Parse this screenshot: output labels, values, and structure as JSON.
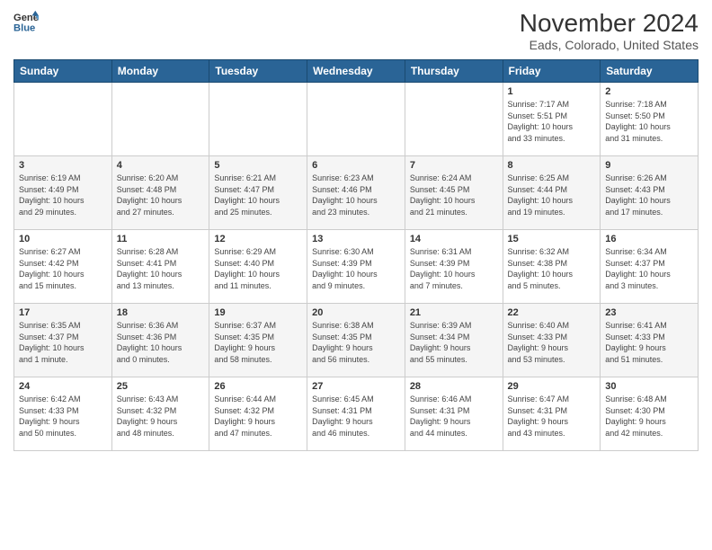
{
  "header": {
    "logo_line1": "General",
    "logo_line2": "Blue",
    "title": "November 2024",
    "subtitle": "Eads, Colorado, United States"
  },
  "weekdays": [
    "Sunday",
    "Monday",
    "Tuesday",
    "Wednesday",
    "Thursday",
    "Friday",
    "Saturday"
  ],
  "weeks": [
    [
      {
        "day": "",
        "info": ""
      },
      {
        "day": "",
        "info": ""
      },
      {
        "day": "",
        "info": ""
      },
      {
        "day": "",
        "info": ""
      },
      {
        "day": "",
        "info": ""
      },
      {
        "day": "1",
        "info": "Sunrise: 7:17 AM\nSunset: 5:51 PM\nDaylight: 10 hours\nand 33 minutes."
      },
      {
        "day": "2",
        "info": "Sunrise: 7:18 AM\nSunset: 5:50 PM\nDaylight: 10 hours\nand 31 minutes."
      }
    ],
    [
      {
        "day": "3",
        "info": "Sunrise: 6:19 AM\nSunset: 4:49 PM\nDaylight: 10 hours\nand 29 minutes."
      },
      {
        "day": "4",
        "info": "Sunrise: 6:20 AM\nSunset: 4:48 PM\nDaylight: 10 hours\nand 27 minutes."
      },
      {
        "day": "5",
        "info": "Sunrise: 6:21 AM\nSunset: 4:47 PM\nDaylight: 10 hours\nand 25 minutes."
      },
      {
        "day": "6",
        "info": "Sunrise: 6:23 AM\nSunset: 4:46 PM\nDaylight: 10 hours\nand 23 minutes."
      },
      {
        "day": "7",
        "info": "Sunrise: 6:24 AM\nSunset: 4:45 PM\nDaylight: 10 hours\nand 21 minutes."
      },
      {
        "day": "8",
        "info": "Sunrise: 6:25 AM\nSunset: 4:44 PM\nDaylight: 10 hours\nand 19 minutes."
      },
      {
        "day": "9",
        "info": "Sunrise: 6:26 AM\nSunset: 4:43 PM\nDaylight: 10 hours\nand 17 minutes."
      }
    ],
    [
      {
        "day": "10",
        "info": "Sunrise: 6:27 AM\nSunset: 4:42 PM\nDaylight: 10 hours\nand 15 minutes."
      },
      {
        "day": "11",
        "info": "Sunrise: 6:28 AM\nSunset: 4:41 PM\nDaylight: 10 hours\nand 13 minutes."
      },
      {
        "day": "12",
        "info": "Sunrise: 6:29 AM\nSunset: 4:40 PM\nDaylight: 10 hours\nand 11 minutes."
      },
      {
        "day": "13",
        "info": "Sunrise: 6:30 AM\nSunset: 4:39 PM\nDaylight: 10 hours\nand 9 minutes."
      },
      {
        "day": "14",
        "info": "Sunrise: 6:31 AM\nSunset: 4:39 PM\nDaylight: 10 hours\nand 7 minutes."
      },
      {
        "day": "15",
        "info": "Sunrise: 6:32 AM\nSunset: 4:38 PM\nDaylight: 10 hours\nand 5 minutes."
      },
      {
        "day": "16",
        "info": "Sunrise: 6:34 AM\nSunset: 4:37 PM\nDaylight: 10 hours\nand 3 minutes."
      }
    ],
    [
      {
        "day": "17",
        "info": "Sunrise: 6:35 AM\nSunset: 4:37 PM\nDaylight: 10 hours\nand 1 minute."
      },
      {
        "day": "18",
        "info": "Sunrise: 6:36 AM\nSunset: 4:36 PM\nDaylight: 10 hours\nand 0 minutes."
      },
      {
        "day": "19",
        "info": "Sunrise: 6:37 AM\nSunset: 4:35 PM\nDaylight: 9 hours\nand 58 minutes."
      },
      {
        "day": "20",
        "info": "Sunrise: 6:38 AM\nSunset: 4:35 PM\nDaylight: 9 hours\nand 56 minutes."
      },
      {
        "day": "21",
        "info": "Sunrise: 6:39 AM\nSunset: 4:34 PM\nDaylight: 9 hours\nand 55 minutes."
      },
      {
        "day": "22",
        "info": "Sunrise: 6:40 AM\nSunset: 4:33 PM\nDaylight: 9 hours\nand 53 minutes."
      },
      {
        "day": "23",
        "info": "Sunrise: 6:41 AM\nSunset: 4:33 PM\nDaylight: 9 hours\nand 51 minutes."
      }
    ],
    [
      {
        "day": "24",
        "info": "Sunrise: 6:42 AM\nSunset: 4:33 PM\nDaylight: 9 hours\nand 50 minutes."
      },
      {
        "day": "25",
        "info": "Sunrise: 6:43 AM\nSunset: 4:32 PM\nDaylight: 9 hours\nand 48 minutes."
      },
      {
        "day": "26",
        "info": "Sunrise: 6:44 AM\nSunset: 4:32 PM\nDaylight: 9 hours\nand 47 minutes."
      },
      {
        "day": "27",
        "info": "Sunrise: 6:45 AM\nSunset: 4:31 PM\nDaylight: 9 hours\nand 46 minutes."
      },
      {
        "day": "28",
        "info": "Sunrise: 6:46 AM\nSunset: 4:31 PM\nDaylight: 9 hours\nand 44 minutes."
      },
      {
        "day": "29",
        "info": "Sunrise: 6:47 AM\nSunset: 4:31 PM\nDaylight: 9 hours\nand 43 minutes."
      },
      {
        "day": "30",
        "info": "Sunrise: 6:48 AM\nSunset: 4:30 PM\nDaylight: 9 hours\nand 42 minutes."
      }
    ]
  ],
  "colors": {
    "header_bg": "#2a6496",
    "header_text": "#ffffff",
    "border": "#cccccc",
    "even_row": "#f5f5f5"
  }
}
